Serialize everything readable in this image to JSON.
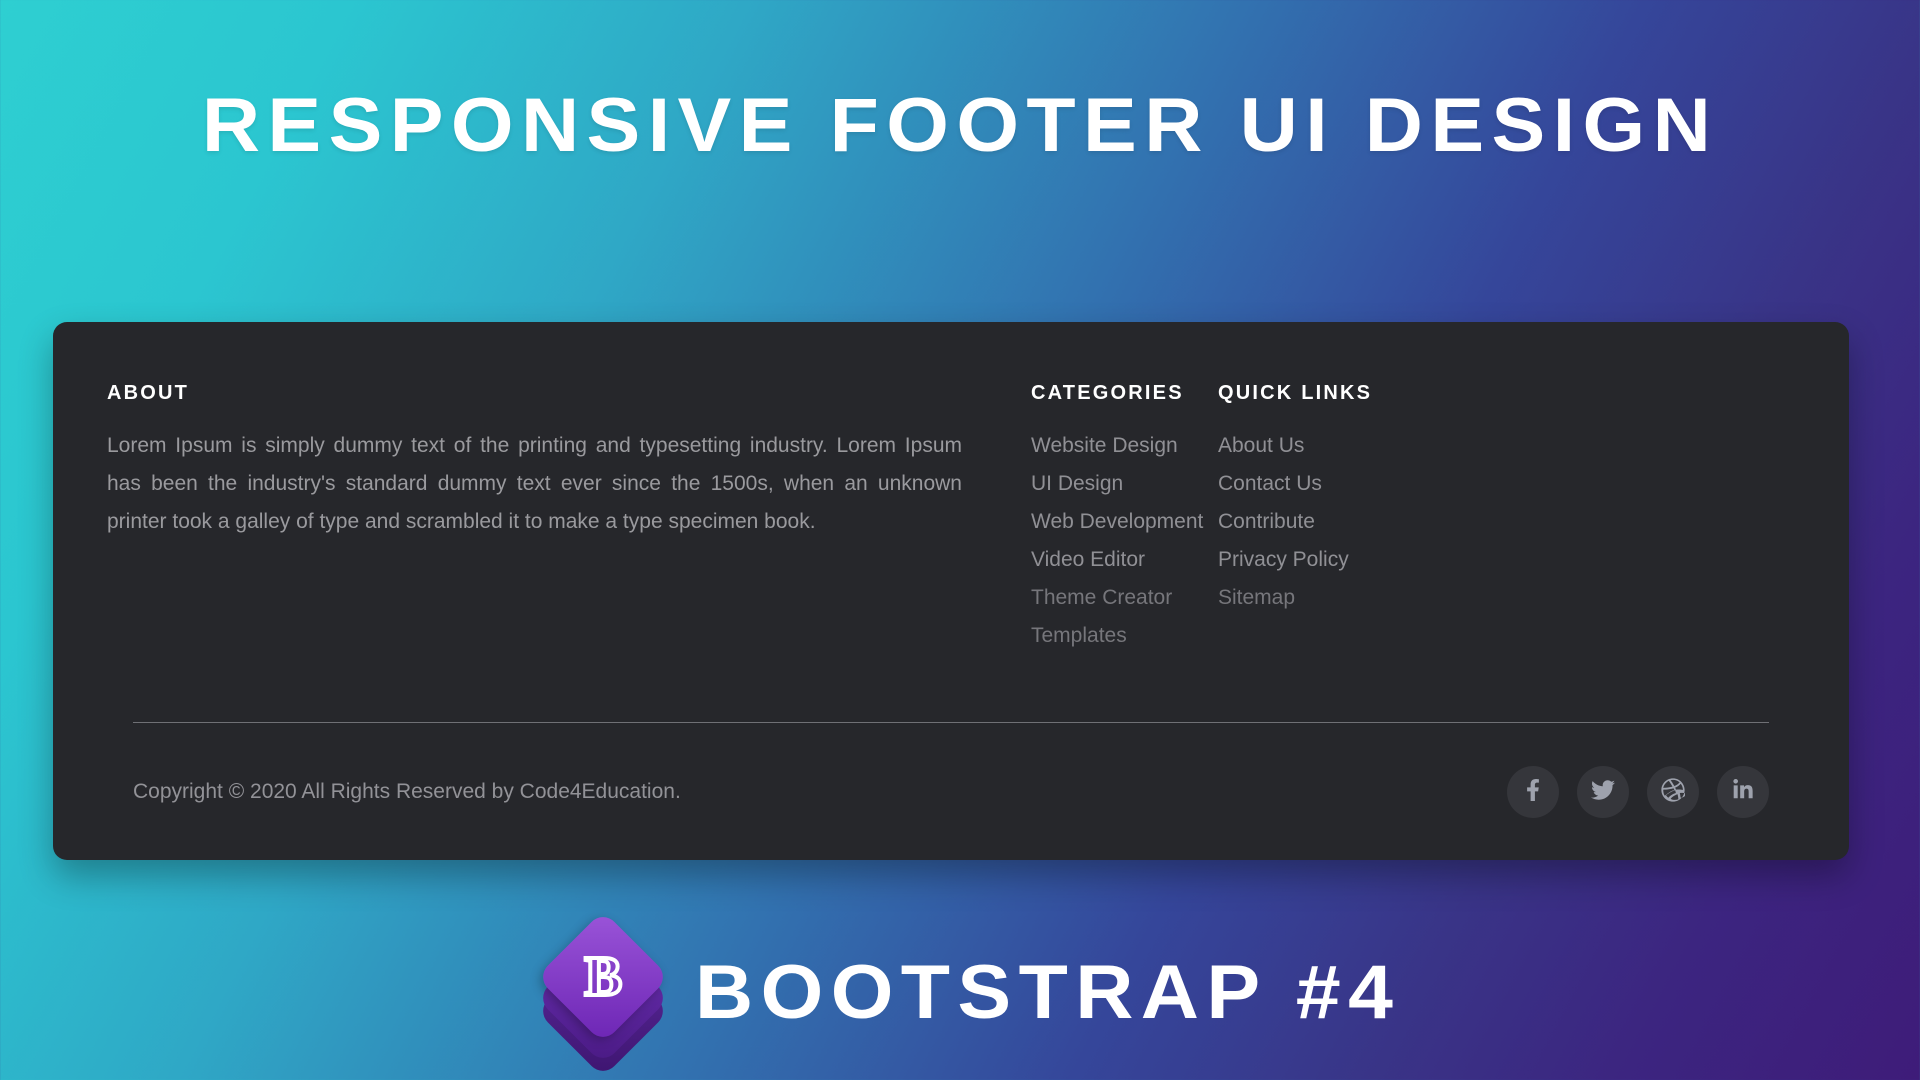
{
  "banner": {
    "title": "RESPONSIVE FOOTER UI DESIGN",
    "subtitle": "BOOTSTRAP #4",
    "logo_letter": "B"
  },
  "footer": {
    "about": {
      "heading": "ABOUT",
      "text": "Lorem Ipsum is simply dummy text of the printing and typesetting industry. Lorem Ipsum has been the industry's standard dummy text ever since the 1500s, when an unknown printer took a galley of type and scrambled it to make a type specimen book."
    },
    "categories": {
      "heading": "CATEGORIES",
      "items": [
        "Website Design",
        "UI Design",
        "Web Development",
        "Video Editor",
        "Theme Creator",
        "Templates"
      ]
    },
    "quick_links": {
      "heading": "QUICK LINKS",
      "items": [
        "About Us",
        "Contact Us",
        "Contribute",
        "Privacy Policy",
        "Sitemap"
      ]
    },
    "copyright": "Copyright © 2020 All Rights Reserved by Code4Education.",
    "socials": [
      {
        "name": "facebook",
        "label": "Facebook"
      },
      {
        "name": "twitter",
        "label": "Twitter"
      },
      {
        "name": "dribbble",
        "label": "Dribbble"
      },
      {
        "name": "linkedin",
        "label": "LinkedIn"
      }
    ]
  },
  "colors": {
    "gradient_start": "#2ECFD1",
    "gradient_end": "#3E1C79",
    "card_background": "#26272B",
    "heading_text": "#FFFFFF",
    "body_text": "#9A9A9E",
    "link_text": "#909095",
    "divider": "#6F7075",
    "social_button": "#35363B",
    "social_glyph": "#9EA2AD",
    "bootstrap_purple": "#9B55D9"
  }
}
